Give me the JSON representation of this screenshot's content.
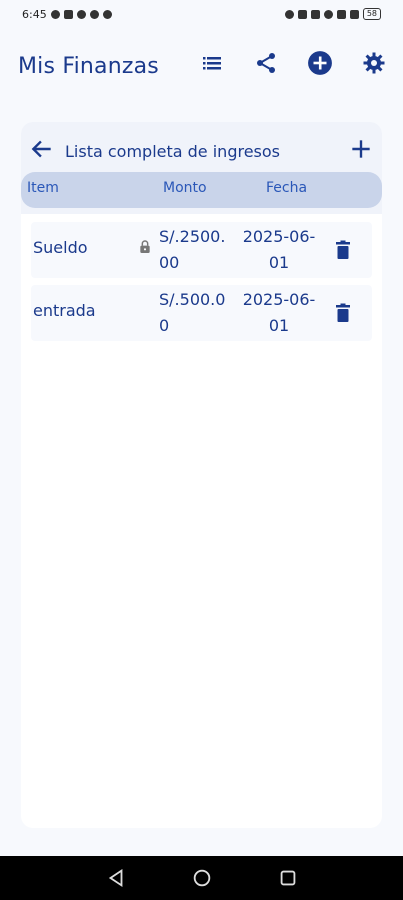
{
  "status_bar": {
    "time": "6:45",
    "battery": "58"
  },
  "app_bar": {
    "title": "Mis Finanzas",
    "actions": [
      "list-icon",
      "share-icon",
      "add-circle-icon",
      "settings-icon"
    ]
  },
  "income_list": {
    "title": "Lista completa de ingresos",
    "columns": {
      "item": "Item",
      "monto": "Monto",
      "fecha": "Fecha"
    },
    "rows": [
      {
        "item": "Sueldo",
        "locked": true,
        "monto": "S/.2500.00",
        "fecha": "2025-06-01"
      },
      {
        "item": "entrada",
        "locked": false,
        "monto": "S/.500.00",
        "fecha": "2025-06-01"
      }
    ]
  },
  "colors": {
    "primary": "#1b3a8c",
    "header_band": "#c9d4ea",
    "background": "#f7f9fd"
  }
}
